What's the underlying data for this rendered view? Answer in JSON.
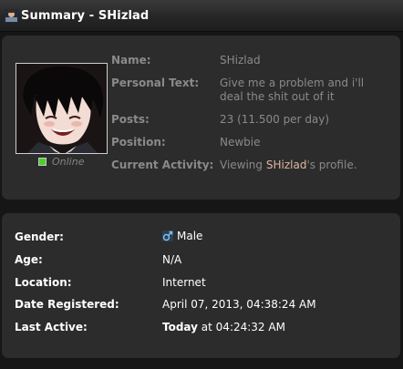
{
  "header": {
    "title": "Summary - SHizlad"
  },
  "profile": {
    "status": "Online",
    "fields": [
      {
        "label": "Name:",
        "value": "SHizlad"
      },
      {
        "label": "Personal Text:",
        "value_line1": "Give me a problem and i'll",
        "value_line2": "deal the shit out of it"
      },
      {
        "label": "Posts:",
        "value": "23 (11.500 per day)"
      },
      {
        "label": "Position:",
        "value": "Newbie"
      },
      {
        "label": "Current Activity:",
        "value_prefix": "Viewing ",
        "value_link": "SHizlad",
        "value_suffix": "'s profile."
      }
    ]
  },
  "details": {
    "gender_label": "Gender:",
    "gender_value": "Male",
    "age_label": "Age:",
    "age_value": "N/A",
    "location_label": "Location:",
    "location_value": "Internet",
    "registered_label": "Date Registered:",
    "registered_value": "April 07, 2013, 04:38:24 AM",
    "last_active_label": "Last Active:",
    "last_active_day": "Today",
    "last_active_time": " at 04:24:32 AM"
  },
  "colors": {
    "background": "#161616",
    "card": "#2c2c2c",
    "link": "#e0b4a4",
    "online_indicator": "#4ccf2a"
  }
}
